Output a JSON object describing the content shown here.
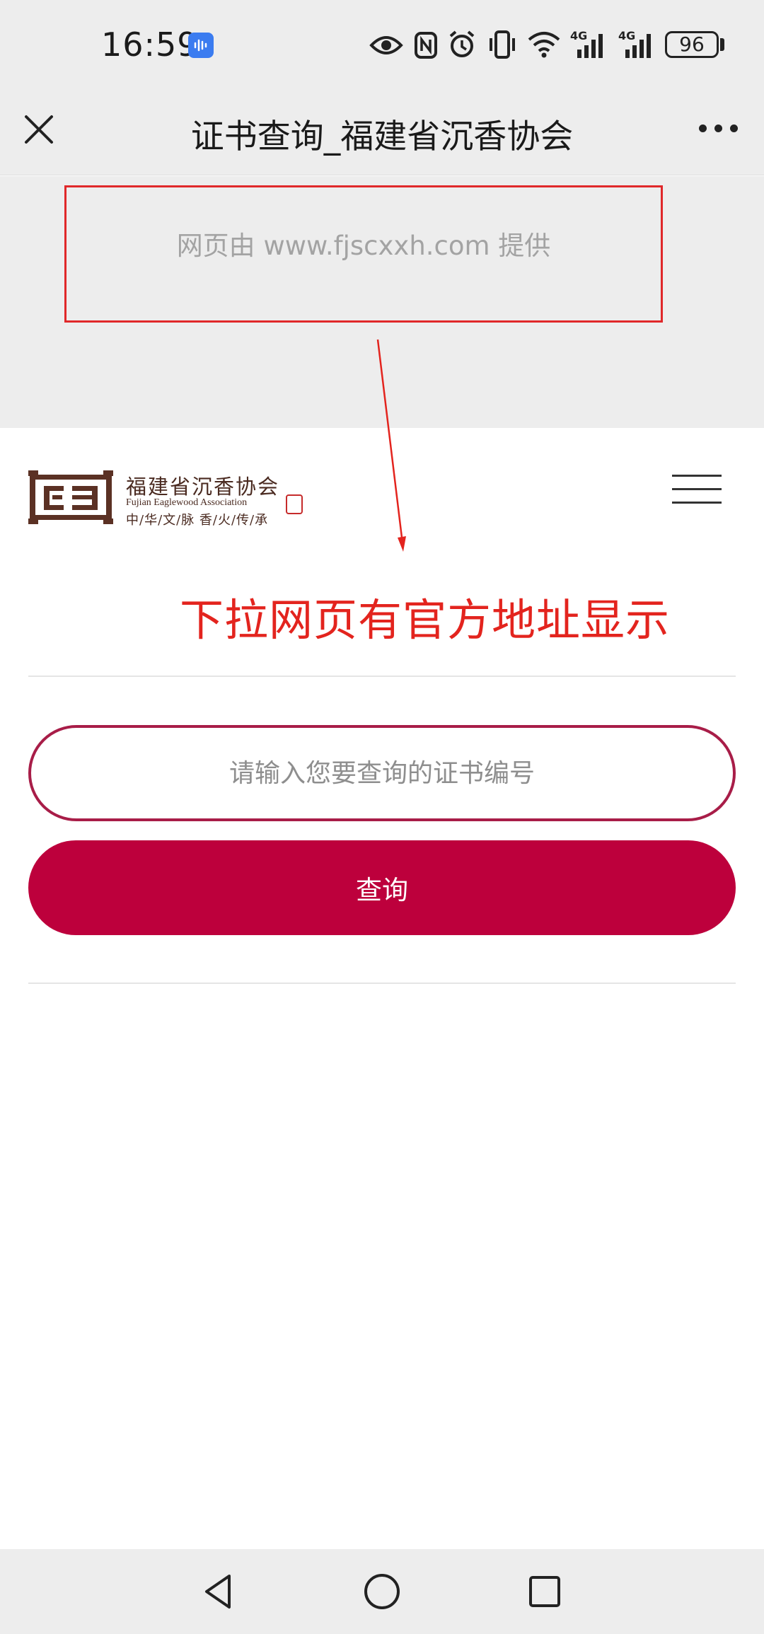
{
  "status_bar": {
    "time": "16:59",
    "battery": "96",
    "icons": [
      "voice-assistant-icon",
      "eye-icon",
      "nfc-icon",
      "alarm-icon",
      "vibrate-icon",
      "wifi-icon",
      "signal-4g-icon",
      "signal-4g-icon",
      "battery-icon"
    ]
  },
  "title_bar": {
    "title": "证书查询_福建省沉香协会",
    "close_icon": "close-icon",
    "more_icon": "more-icon"
  },
  "pull_area": {
    "provider_text": "网页由 www.fjscxxh.com 提供"
  },
  "site_header": {
    "logo_name": "福建省沉香协会",
    "logo_english": "Fujian Eaglewood Association",
    "logo_slogan": "中/华/文/脉  香/火/传/承",
    "menu_icon": "hamburger-menu-icon"
  },
  "annotation": {
    "text": "下拉网页有官方地址显示"
  },
  "search": {
    "placeholder": "请输入您要查询的证书编号",
    "button_label": "查询"
  },
  "colors": {
    "accent": "#bd003c",
    "input_border": "#a81d48",
    "annotation_red": "#e3241e",
    "chrome_gray": "#ededed"
  }
}
